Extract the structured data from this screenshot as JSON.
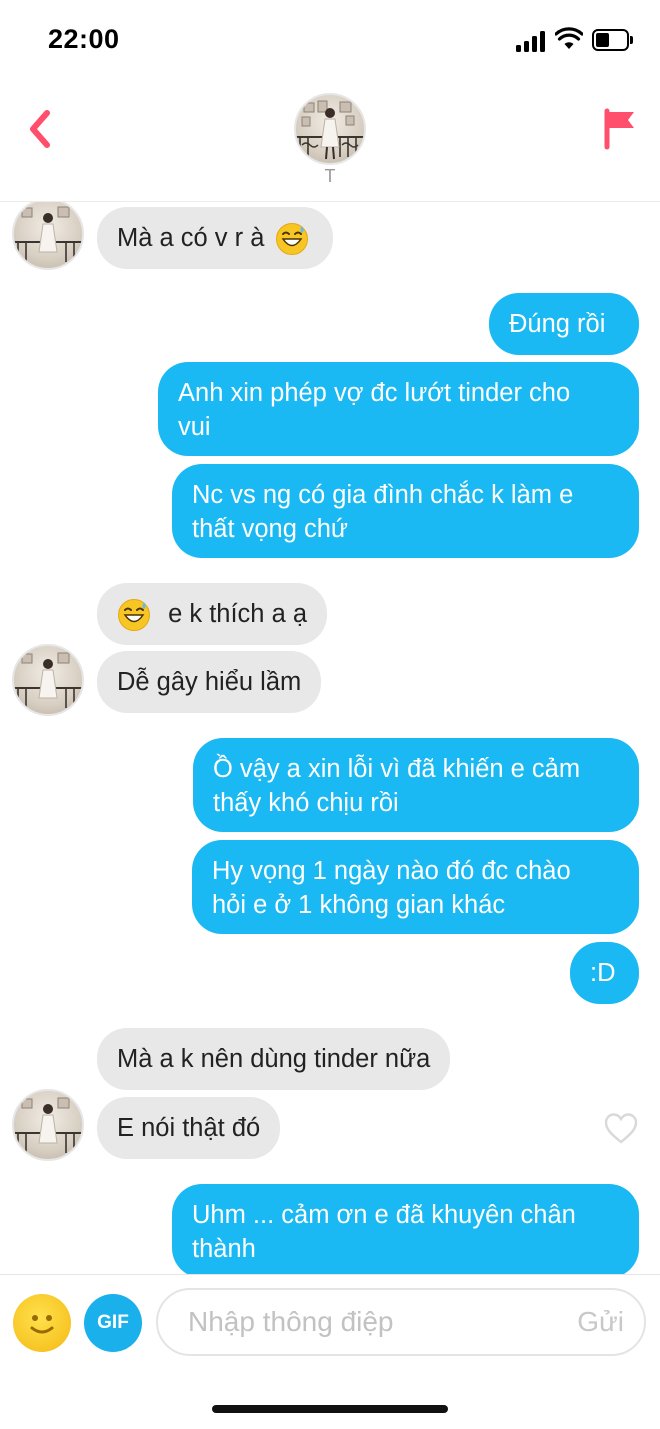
{
  "status_bar": {
    "time": "22:00"
  },
  "header": {
    "match_name": "T",
    "back_icon": "chevron-left-icon",
    "report_icon": "flag-icon",
    "accent_color": "#ff4f6d"
  },
  "messages": [
    {
      "from": "them",
      "text": "Mà a có v r à",
      "emoji_after": "sweat-smile-emoji"
    },
    {
      "from": "me",
      "text": "Đúng rồi"
    },
    {
      "from": "me",
      "line1": "Anh xin phép vợ đc lướt tinder cho",
      "line2": "vui"
    },
    {
      "from": "me",
      "line1": "Nc vs ng có gia đình chắc k làm e",
      "line2": "thất vọng chứ"
    },
    {
      "from": "them",
      "text": "e k thích a ạ",
      "emoji_before": "sweat-smile-emoji"
    },
    {
      "from": "them",
      "text": "Dễ gây hiểu lầm"
    },
    {
      "from": "me",
      "line1": "Ồ vậy a xin lỗi vì đã khiến e cảm",
      "line2": "thấy khó chịu rồi"
    },
    {
      "from": "me",
      "line1": "Hy vọng 1 ngày nào đó đc  chào",
      "line2": "hỏi e ở 1 không gian khác"
    },
    {
      "from": "me",
      "text": ":D"
    },
    {
      "from": "them",
      "text": "Mà a k nên dùng tinder nữa"
    },
    {
      "from": "them",
      "text": "E nói thật đó"
    },
    {
      "from": "me",
      "line1": "Uhm ... cảm ơn e đã khuyên chân",
      "line2": "thành"
    }
  ],
  "composer": {
    "gif_label": "GIF",
    "placeholder": "Nhập thông điệp",
    "send_label": "Gửi"
  },
  "colors": {
    "outgoing_bubble": "#1ab9f3",
    "incoming_bubble": "#e8e8e8",
    "gif_button": "#1ab0ec"
  }
}
